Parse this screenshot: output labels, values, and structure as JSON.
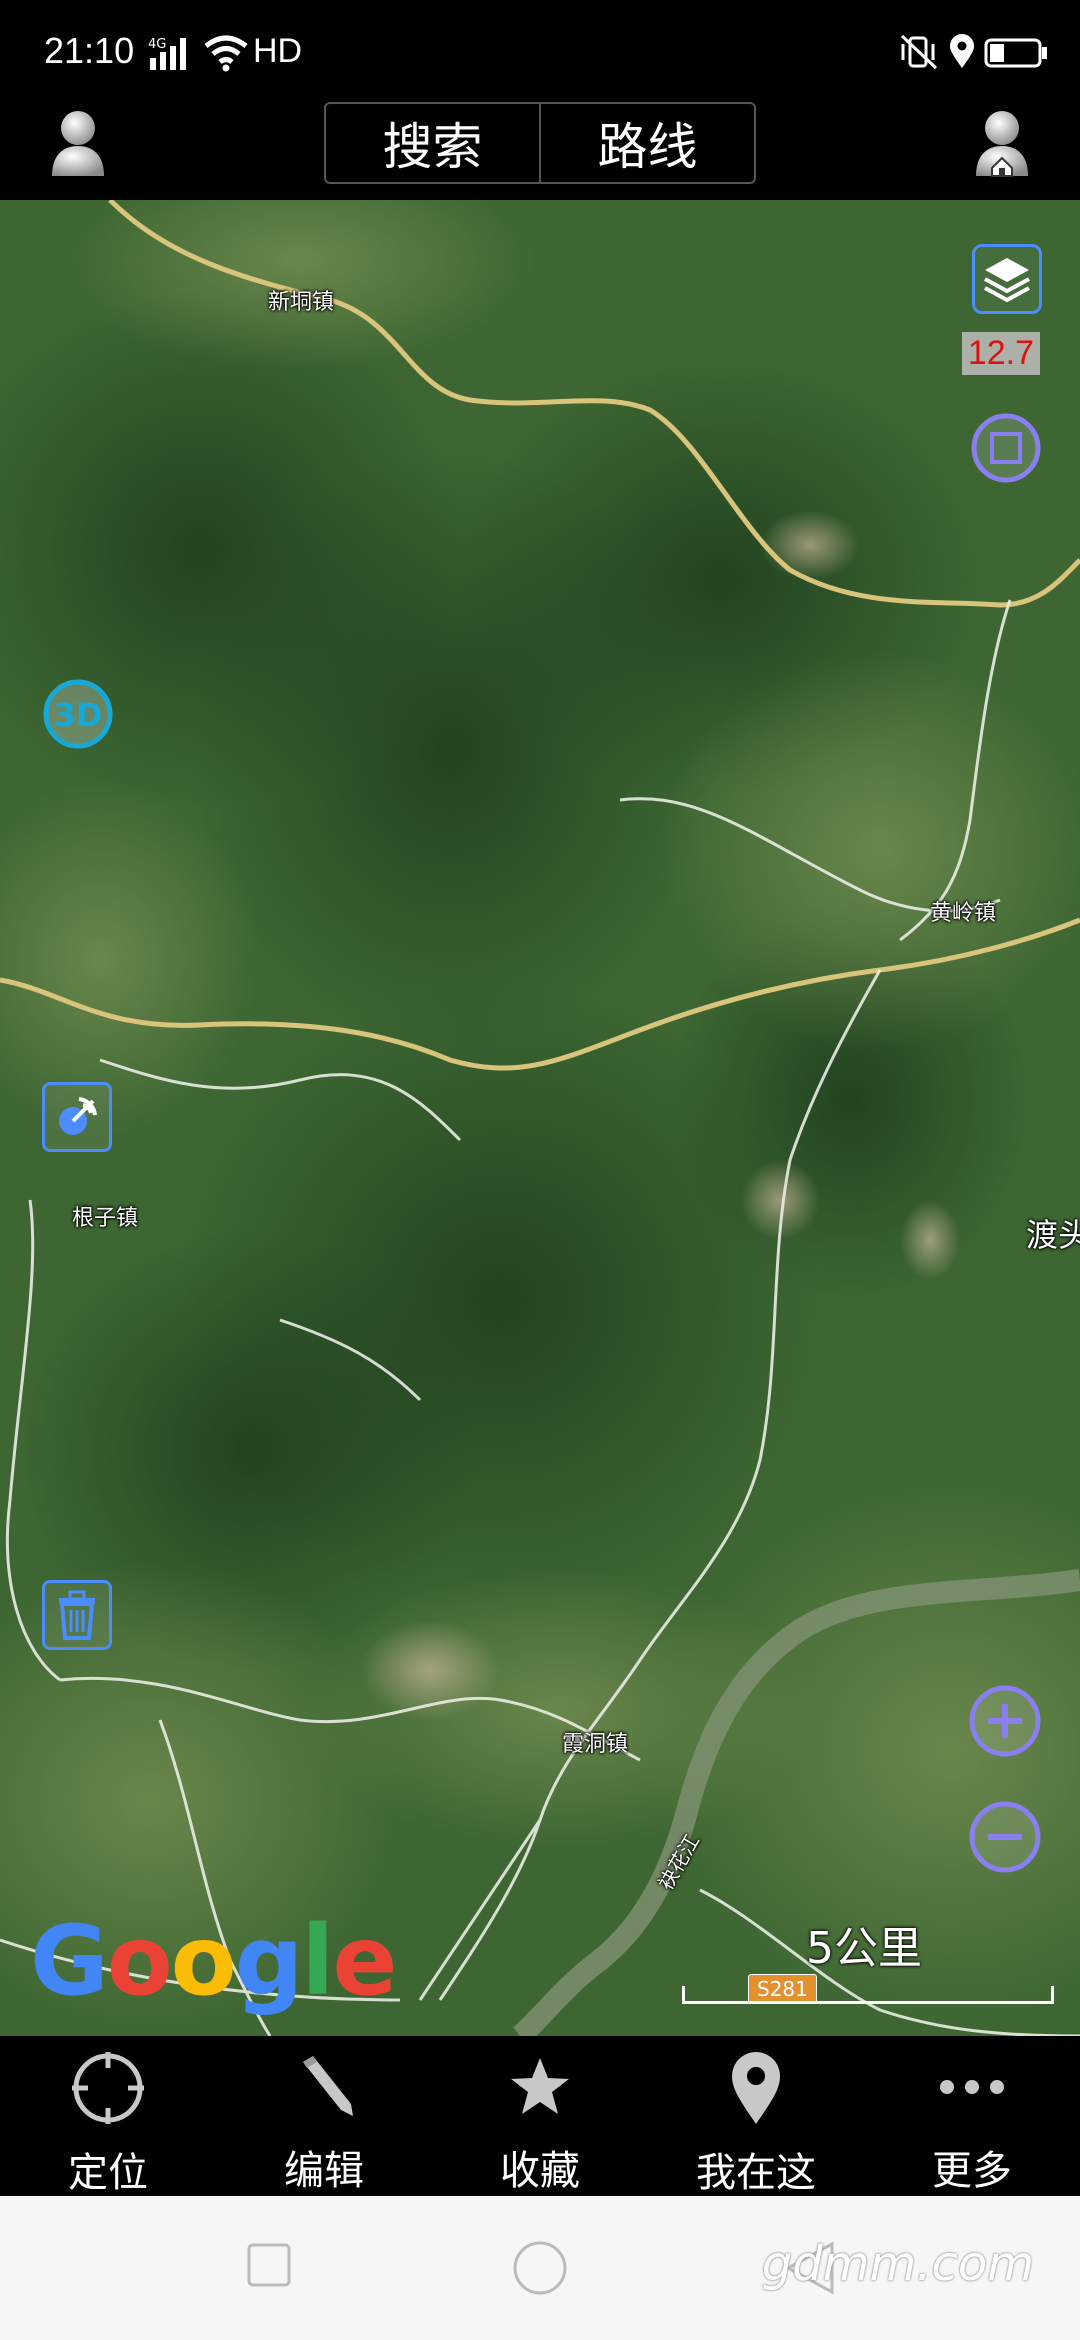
{
  "status": {
    "time": "21:10",
    "network": "4G",
    "hd": "HD"
  },
  "header": {
    "tabs": [
      "搜索",
      "路线"
    ]
  },
  "map": {
    "zoom_level": "12.7",
    "places": {
      "xintong": "新垌镇",
      "huangling": "黄岭镇",
      "genzi": "根子镇",
      "xiadong": "霞洞镇",
      "dutou": "渡头",
      "river": "袂花江"
    },
    "road_badge": "S281",
    "scale_label": "5公里",
    "button_3d": "3D",
    "brand": [
      "G",
      "o",
      "o",
      "g",
      "l",
      "e"
    ],
    "brand_colors": [
      "#4285F4",
      "#EA4335",
      "#FBBC05",
      "#4285F4",
      "#34A853",
      "#EA4335"
    ]
  },
  "bottom_nav": {
    "locate": "定位",
    "edit": "编辑",
    "favorite": "收藏",
    "im_here": "我在这",
    "more": "更多"
  },
  "watermark": "gdmm.com",
  "colors": {
    "accent_blue": "#4b8dff",
    "control_purple": "#8a7ff0"
  }
}
